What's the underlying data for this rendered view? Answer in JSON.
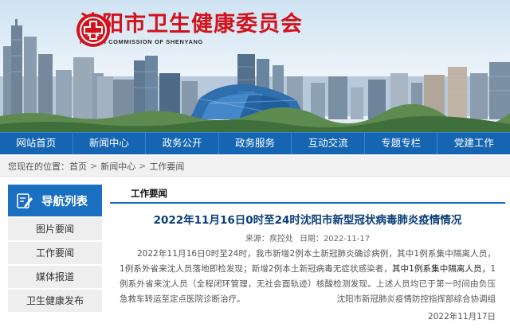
{
  "header": {
    "title_cn": "沈阳市卫生健康委员会",
    "title_en": "HEALTH COMMISSION OF SHENYANG",
    "brand_red": "#d3121b"
  },
  "nav": {
    "color": "#1565b3",
    "items": [
      "网站首页",
      "新闻中心",
      "政务公开",
      "政务服务",
      "互动交流",
      "专题专栏",
      "党建工作"
    ]
  },
  "breadcrumb": {
    "prefix": "您现在的位置：",
    "items": [
      "首页",
      "新闻中心",
      "工作要闻"
    ],
    "separator": ">"
  },
  "sidebar": {
    "title": "导航列表",
    "icon": "edit-note-icon",
    "items": [
      "图片要闻",
      "工作要闻",
      "媒体报道",
      "卫生健康发布"
    ]
  },
  "main": {
    "tab": "工作要闻",
    "title": "2022年11月16日0时至24时沈阳市新型冠状病毒肺炎疫情情况",
    "source_label": "来源：",
    "source": "疾控处",
    "date_label": "日期：",
    "date": "2022-11-17",
    "para_1": "2022年11月16日0时至24时，我市新增2例本土新冠肺炎确诊病例，其中1例系集中隔离人员，1例系外省来沈人员落地即检发现；新增2例本土新冠病毒无症状感染者，",
    "para_hl": "其中1例系集中隔离人员，",
    "para_2": "1例系外省来沈人员（全程闭环管理，无社会面轨迹）核酸检测发现。上述人员均已于第一时间由负压急救车转运至定点医院诊断治疗。",
    "signature_org": "沈阳市新冠肺炎疫情防控指挥部综合协调组",
    "signature_date": "2022年11月17日"
  }
}
